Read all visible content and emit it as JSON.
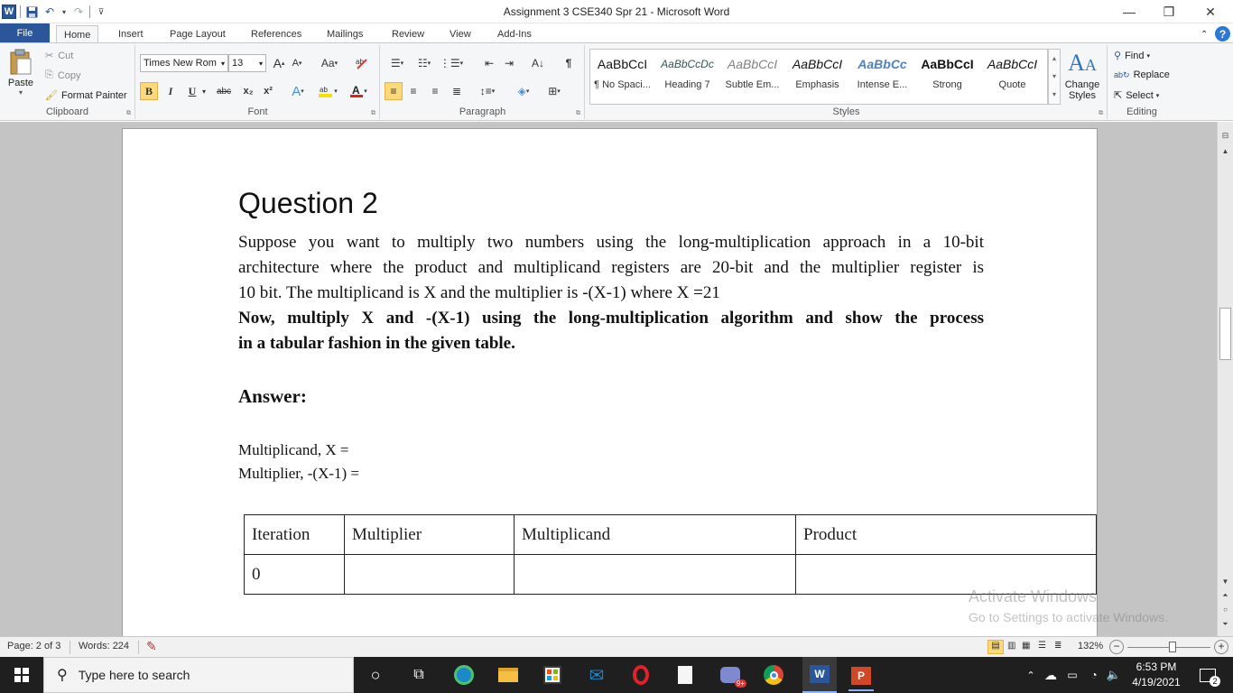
{
  "window": {
    "title": "Assignment 3 CSE340 Spr 21  -  Microsoft Word"
  },
  "tabs": [
    "File",
    "Home",
    "Insert",
    "Page Layout",
    "References",
    "Mailings",
    "Review",
    "View",
    "Add-Ins"
  ],
  "clipboard": {
    "paste": "Paste",
    "cut": "Cut",
    "copy": "Copy",
    "format_painter": "Format Painter",
    "label": "Clipboard"
  },
  "font": {
    "name": "Times New Rom",
    "size": "13",
    "label": "Font",
    "grow": "A",
    "shrink": "A",
    "change_case": "Aa",
    "bold": "B",
    "italic": "I",
    "underline": "U",
    "strike": "abc",
    "subscript": "x₂",
    "superscript": "x²"
  },
  "paragraph": {
    "label": "Paragraph"
  },
  "styles": {
    "label": "Styles",
    "items": [
      {
        "preview": "AaBbCcI",
        "name": "¶ No Spaci..."
      },
      {
        "preview": "AaBbCcDc",
        "name": "Heading 7"
      },
      {
        "preview": "AaBbCcI",
        "name": "Subtle Em..."
      },
      {
        "preview": "AaBbCcI",
        "name": "Emphasis"
      },
      {
        "preview": "AaBbCc",
        "name": "Intense E..."
      },
      {
        "preview": "AaBbCcI",
        "name": "Strong"
      },
      {
        "preview": "AaBbCcI",
        "name": "Quote"
      }
    ],
    "change_styles": "Change Styles"
  },
  "editing": {
    "label": "Editing",
    "find": "Find",
    "replace": "Replace",
    "select": "Select"
  },
  "document": {
    "heading": "Question 2",
    "p1_lines": [
      "Suppose you want to multiply two numbers using the long-multiplication approach in a 10-bit",
      "architecture where the product and multiplicand registers are 20-bit and the multiplier register is",
      "10 bit. The multiplicand is X and the multiplier is -(X-1) where X =21"
    ],
    "p2_lines": [
      "Now, multiply X and -(X-1) using the long-multiplication algorithm and show the process",
      "in a tabular fashion in the given table."
    ],
    "answer": "Answer:",
    "multiplicand_line": "Multiplicand,  X =",
    "multiplier_line": "Multiplier,  -(X-1) =",
    "table": {
      "headers": [
        "Iteration",
        "Multiplier",
        "Multiplicand",
        "Product"
      ],
      "rows": [
        [
          "0",
          "",
          "",
          ""
        ]
      ]
    }
  },
  "watermark": {
    "line1": "Activate Windows",
    "line2": "Go to Settings to activate Windows."
  },
  "status": {
    "page": "Page: 2 of 3",
    "words": "Words: 224",
    "zoom": "132%"
  },
  "taskbar": {
    "search_placeholder": "Type here to search",
    "time": "6:53 PM",
    "date": "4/19/2021",
    "notifications": "2",
    "badge": "9+"
  }
}
